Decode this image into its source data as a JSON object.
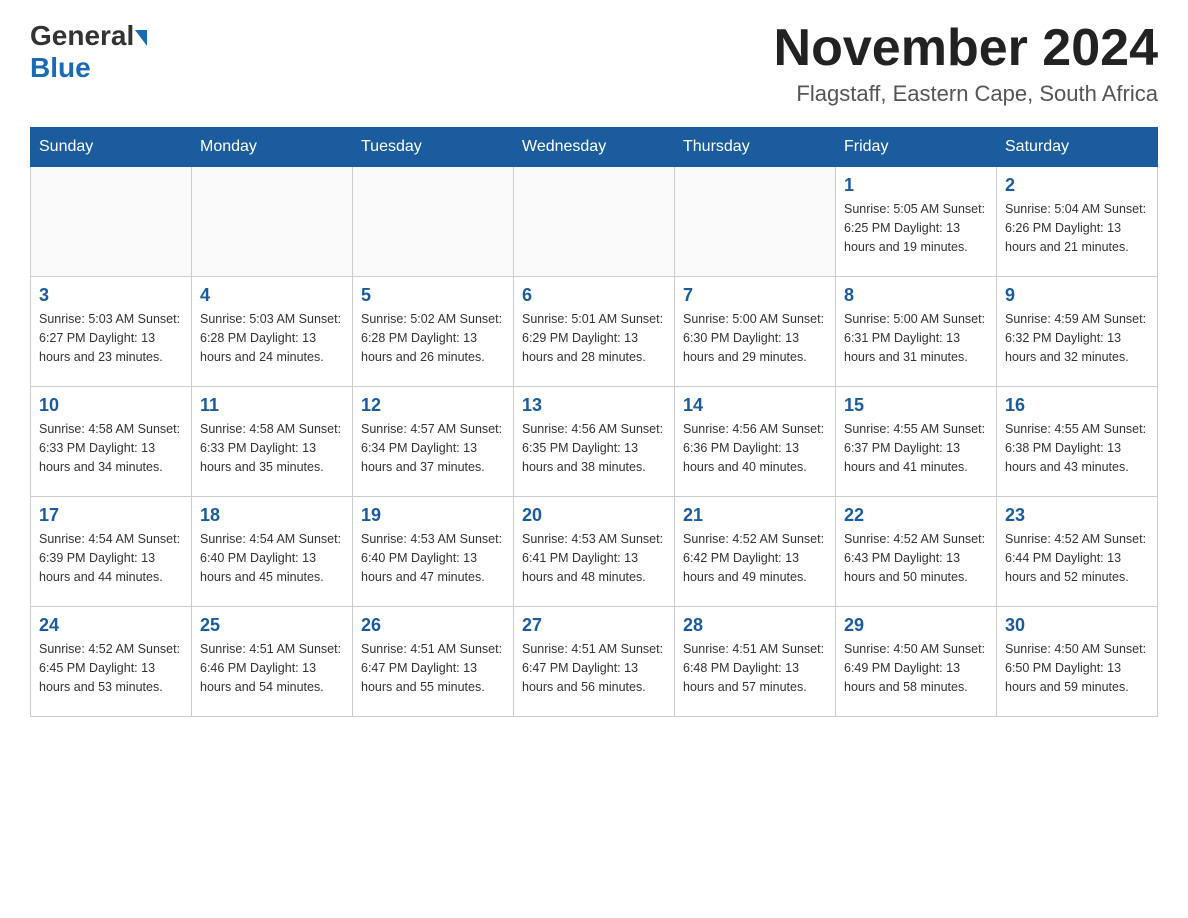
{
  "header": {
    "logo_general": "General",
    "logo_blue": "Blue",
    "month_title": "November 2024",
    "location": "Flagstaff, Eastern Cape, South Africa"
  },
  "weekdays": [
    "Sunday",
    "Monday",
    "Tuesday",
    "Wednesday",
    "Thursday",
    "Friday",
    "Saturday"
  ],
  "weeks": [
    [
      {
        "day": "",
        "info": ""
      },
      {
        "day": "",
        "info": ""
      },
      {
        "day": "",
        "info": ""
      },
      {
        "day": "",
        "info": ""
      },
      {
        "day": "",
        "info": ""
      },
      {
        "day": "1",
        "info": "Sunrise: 5:05 AM\nSunset: 6:25 PM\nDaylight: 13 hours\nand 19 minutes."
      },
      {
        "day": "2",
        "info": "Sunrise: 5:04 AM\nSunset: 6:26 PM\nDaylight: 13 hours\nand 21 minutes."
      }
    ],
    [
      {
        "day": "3",
        "info": "Sunrise: 5:03 AM\nSunset: 6:27 PM\nDaylight: 13 hours\nand 23 minutes."
      },
      {
        "day": "4",
        "info": "Sunrise: 5:03 AM\nSunset: 6:28 PM\nDaylight: 13 hours\nand 24 minutes."
      },
      {
        "day": "5",
        "info": "Sunrise: 5:02 AM\nSunset: 6:28 PM\nDaylight: 13 hours\nand 26 minutes."
      },
      {
        "day": "6",
        "info": "Sunrise: 5:01 AM\nSunset: 6:29 PM\nDaylight: 13 hours\nand 28 minutes."
      },
      {
        "day": "7",
        "info": "Sunrise: 5:00 AM\nSunset: 6:30 PM\nDaylight: 13 hours\nand 29 minutes."
      },
      {
        "day": "8",
        "info": "Sunrise: 5:00 AM\nSunset: 6:31 PM\nDaylight: 13 hours\nand 31 minutes."
      },
      {
        "day": "9",
        "info": "Sunrise: 4:59 AM\nSunset: 6:32 PM\nDaylight: 13 hours\nand 32 minutes."
      }
    ],
    [
      {
        "day": "10",
        "info": "Sunrise: 4:58 AM\nSunset: 6:33 PM\nDaylight: 13 hours\nand 34 minutes."
      },
      {
        "day": "11",
        "info": "Sunrise: 4:58 AM\nSunset: 6:33 PM\nDaylight: 13 hours\nand 35 minutes."
      },
      {
        "day": "12",
        "info": "Sunrise: 4:57 AM\nSunset: 6:34 PM\nDaylight: 13 hours\nand 37 minutes."
      },
      {
        "day": "13",
        "info": "Sunrise: 4:56 AM\nSunset: 6:35 PM\nDaylight: 13 hours\nand 38 minutes."
      },
      {
        "day": "14",
        "info": "Sunrise: 4:56 AM\nSunset: 6:36 PM\nDaylight: 13 hours\nand 40 minutes."
      },
      {
        "day": "15",
        "info": "Sunrise: 4:55 AM\nSunset: 6:37 PM\nDaylight: 13 hours\nand 41 minutes."
      },
      {
        "day": "16",
        "info": "Sunrise: 4:55 AM\nSunset: 6:38 PM\nDaylight: 13 hours\nand 43 minutes."
      }
    ],
    [
      {
        "day": "17",
        "info": "Sunrise: 4:54 AM\nSunset: 6:39 PM\nDaylight: 13 hours\nand 44 minutes."
      },
      {
        "day": "18",
        "info": "Sunrise: 4:54 AM\nSunset: 6:40 PM\nDaylight: 13 hours\nand 45 minutes."
      },
      {
        "day": "19",
        "info": "Sunrise: 4:53 AM\nSunset: 6:40 PM\nDaylight: 13 hours\nand 47 minutes."
      },
      {
        "day": "20",
        "info": "Sunrise: 4:53 AM\nSunset: 6:41 PM\nDaylight: 13 hours\nand 48 minutes."
      },
      {
        "day": "21",
        "info": "Sunrise: 4:52 AM\nSunset: 6:42 PM\nDaylight: 13 hours\nand 49 minutes."
      },
      {
        "day": "22",
        "info": "Sunrise: 4:52 AM\nSunset: 6:43 PM\nDaylight: 13 hours\nand 50 minutes."
      },
      {
        "day": "23",
        "info": "Sunrise: 4:52 AM\nSunset: 6:44 PM\nDaylight: 13 hours\nand 52 minutes."
      }
    ],
    [
      {
        "day": "24",
        "info": "Sunrise: 4:52 AM\nSunset: 6:45 PM\nDaylight: 13 hours\nand 53 minutes."
      },
      {
        "day": "25",
        "info": "Sunrise: 4:51 AM\nSunset: 6:46 PM\nDaylight: 13 hours\nand 54 minutes."
      },
      {
        "day": "26",
        "info": "Sunrise: 4:51 AM\nSunset: 6:47 PM\nDaylight: 13 hours\nand 55 minutes."
      },
      {
        "day": "27",
        "info": "Sunrise: 4:51 AM\nSunset: 6:47 PM\nDaylight: 13 hours\nand 56 minutes."
      },
      {
        "day": "28",
        "info": "Sunrise: 4:51 AM\nSunset: 6:48 PM\nDaylight: 13 hours\nand 57 minutes."
      },
      {
        "day": "29",
        "info": "Sunrise: 4:50 AM\nSunset: 6:49 PM\nDaylight: 13 hours\nand 58 minutes."
      },
      {
        "day": "30",
        "info": "Sunrise: 4:50 AM\nSunset: 6:50 PM\nDaylight: 13 hours\nand 59 minutes."
      }
    ]
  ]
}
